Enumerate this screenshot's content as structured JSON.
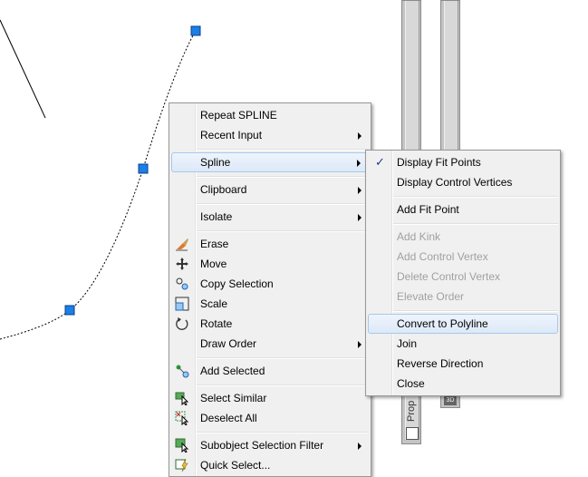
{
  "context_menu": {
    "items": [
      {
        "label": "Repeat SPLINE"
      },
      {
        "label": "Recent Input"
      },
      {
        "label": "Spline"
      },
      {
        "label": "Clipboard"
      },
      {
        "label": "Isolate"
      },
      {
        "label": "Erase",
        "icon": "eraser-icon"
      },
      {
        "label": "Move",
        "icon": "move-icon"
      },
      {
        "label": "Copy Selection",
        "icon": "copy-selection-icon"
      },
      {
        "label": "Scale",
        "icon": "scale-icon"
      },
      {
        "label": "Rotate",
        "icon": "rotate-icon"
      },
      {
        "label": "Draw Order"
      },
      {
        "label": "Add Selected",
        "icon": "add-selected-icon"
      },
      {
        "label": "Select Similar",
        "icon": "select-similar-icon"
      },
      {
        "label": "Deselect All",
        "icon": "deselect-all-icon"
      },
      {
        "label": "Subobject Selection Filter",
        "icon": "subobject-filter-icon"
      },
      {
        "label": "Quick Select...",
        "icon": "quick-select-icon"
      }
    ]
  },
  "spline_submenu": {
    "items": [
      {
        "label": "Display Fit Points",
        "checked": true
      },
      {
        "label": "Display Control Vertices"
      },
      {
        "label": "Add Fit Point"
      },
      {
        "label": "Add Kink",
        "enabled": false
      },
      {
        "label": "Add Control Vertex",
        "enabled": false
      },
      {
        "label": "Delete Control Vertex",
        "enabled": false
      },
      {
        "label": "Elevate Order",
        "enabled": false
      },
      {
        "label": "Convert to Polyline",
        "highlighted": true
      },
      {
        "label": "Join"
      },
      {
        "label": "Reverse Direction"
      },
      {
        "label": "Close"
      }
    ]
  },
  "palette_tab": {
    "label": "Prop"
  },
  "colors": {
    "grip": "#1a7fe6",
    "highlight_border": "#a8c8ea",
    "menu_bg": "#f0f0f0"
  }
}
